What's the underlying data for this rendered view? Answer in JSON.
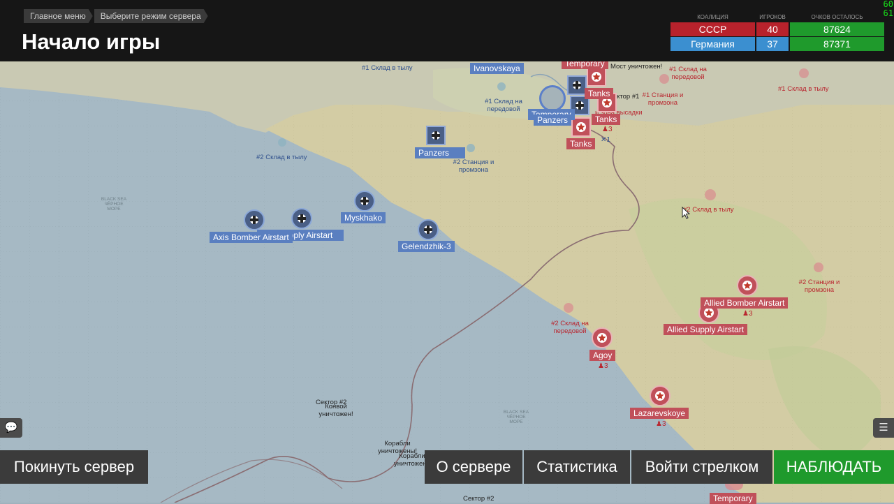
{
  "breadcrumb": [
    "Главное меню",
    "Выберите режим сервера"
  ],
  "page_title": "Начало игры",
  "fps": [
    "60",
    "61"
  ],
  "scoreboard": {
    "headers": [
      "КОАЛИЦИЯ",
      "ИГРОКОВ",
      "ОЧКОВ ОСТАЛОСЬ"
    ],
    "rows": [
      {
        "name": "СССР",
        "players": "40",
        "points": "87624",
        "color": "#b8222c"
      },
      {
        "name": "Германия",
        "players": "37",
        "points": "87371",
        "color": "#3b8fd0"
      }
    ]
  },
  "colors": {
    "points_bar": "#1f9a2c",
    "axis": "#5a7fc0",
    "allied": "#c0505a",
    "land": "#cfc9a3",
    "sea": "#a6b9c4"
  },
  "map": {
    "blue_labels": [
      "Ivanovskaya",
      "Panzers",
      "Myskhako",
      "Axis Bomber Airstart",
      "Axis Supply Airstart",
      "Gelendzhik-3",
      "Temporary",
      "Panzers"
    ],
    "red_labels": [
      "Temporary",
      "Tanks",
      "Tanks",
      "Tanks",
      "Allied Bomber Airstart",
      "Allied Supply Airstart",
      "Agoy",
      "Lazarevskoye",
      "Temporary"
    ],
    "texts_red": [
      "Мост уничтожен!",
      "#1 Склад на передовой",
      "#1 Склад в тылу",
      "#1 Станция и промзона",
      "Сектор #1",
      "#2 Склад в тылу",
      "#2 Станция и промзона",
      "#2 Склад на передовой",
      "и зона высадки"
    ],
    "texts_blue": [
      "#1 Склад в тылу",
      "#1 Склад на передовой",
      "#2 Склад в тылу",
      "#2 Станция и промзона"
    ],
    "texts_dark": [
      "Сектор #2",
      "Конвой уничтожен!",
      "Корабли уничтожены!",
      "Корабли уничтожены",
      "Сектор #2"
    ],
    "sea_names": [
      "BLACK SEA ЧЁРНОЕ МОРЕ",
      "BLACK SEA ЧЁРНОЕ МОРЕ"
    ],
    "unit_counts": [
      "3",
      "1",
      "3",
      "3",
      "3"
    ]
  },
  "buttons": {
    "leave": "Покинуть сервер",
    "about": "О сервере",
    "stats": "Статистика",
    "gunner": "Войти стрелком",
    "spectate": "НАБЛЮДАТЬ"
  },
  "icons": {
    "chat": "chat-icon",
    "list": "list-icon",
    "axis": "balkenkreuz-icon",
    "allied": "red-star-icon"
  }
}
